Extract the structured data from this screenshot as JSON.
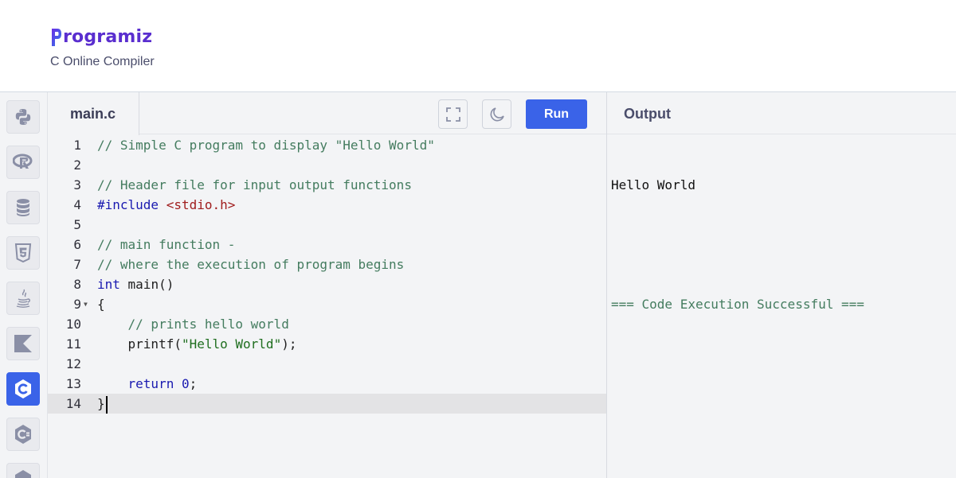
{
  "header": {
    "logo_text": "rogramiz",
    "logo_mark": "P",
    "subtitle": "C Online Compiler"
  },
  "sidebar": {
    "languages": [
      {
        "name": "python",
        "icon": "python-icon",
        "active": false
      },
      {
        "name": "r",
        "icon": "r-icon",
        "active": false
      },
      {
        "name": "sql",
        "icon": "database-icon",
        "active": false
      },
      {
        "name": "html",
        "icon": "html5-icon",
        "active": false
      },
      {
        "name": "java",
        "icon": "java-icon",
        "active": false
      },
      {
        "name": "kotlin",
        "icon": "kotlin-icon",
        "active": false
      },
      {
        "name": "c",
        "icon": "c-icon",
        "active": true
      },
      {
        "name": "csharp",
        "icon": "csharp-icon",
        "active": false
      },
      {
        "name": "cpp",
        "icon": "cpp-icon",
        "active": false
      }
    ]
  },
  "editor": {
    "file_tab": "main.c",
    "run_label": "Run",
    "lines": [
      {
        "n": "1",
        "text": "// Simple C program to display \"Hello World\""
      },
      {
        "n": "2",
        "text": ""
      },
      {
        "n": "3",
        "text": "// Header file for input output functions"
      },
      {
        "n": "4",
        "text": "#include <stdio.h>"
      },
      {
        "n": "5",
        "text": ""
      },
      {
        "n": "6",
        "text": "// main function -"
      },
      {
        "n": "7",
        "text": "// where the execution of program begins"
      },
      {
        "n": "8",
        "text": "int main()"
      },
      {
        "n": "9",
        "text": "{"
      },
      {
        "n": "10",
        "text": "    // prints hello world"
      },
      {
        "n": "11",
        "text": "    printf(\"Hello World\");"
      },
      {
        "n": "12",
        "text": ""
      },
      {
        "n": "13",
        "text": "    return 0;"
      },
      {
        "n": "14",
        "text": "}"
      }
    ]
  },
  "output": {
    "title": "Output",
    "lines": [
      "Hello World",
      "",
      "=== Code Execution Successful ==="
    ]
  },
  "colors": {
    "accent": "#3a63e8",
    "brand": "#5a2ecf",
    "comment": "#447c5f",
    "keyword": "#1a1ab0",
    "header_string": "#a01d1d",
    "string": "#1f6e1f"
  }
}
